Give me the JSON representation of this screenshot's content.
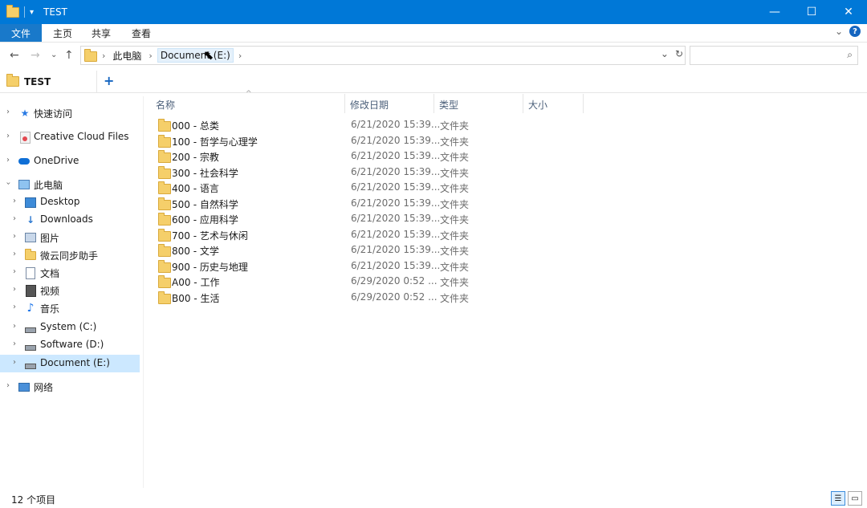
{
  "window": {
    "title": "TEST",
    "controls": {
      "minimize": "—",
      "maximize": "☐",
      "close": "✕"
    }
  },
  "ribbon": {
    "file_tab": "文件",
    "tabs": [
      "主页",
      "共享",
      "查看"
    ],
    "collapse_glyph": "⌄",
    "help_glyph": "?"
  },
  "address": {
    "back": "←",
    "forward": "→",
    "history": "⌄",
    "up": "↑",
    "crumbs": [
      "此电脑",
      "Document (E:)"
    ],
    "dropdown": "⌄",
    "refresh": "↻"
  },
  "search": {
    "placeholder": "",
    "icon": "search-icon"
  },
  "tabbar": {
    "tab_label": "TEST",
    "add_glyph": "+"
  },
  "nav": {
    "items": [
      {
        "label": "快速访问",
        "icon": "star-icon"
      },
      {
        "label": "Creative Cloud Files",
        "icon": "creative-cloud-icon"
      },
      {
        "label": "OneDrive",
        "icon": "cloud-icon"
      },
      {
        "label": "此电脑",
        "icon": "computer-icon"
      },
      {
        "label": "Desktop",
        "icon": "desktop-icon"
      },
      {
        "label": "Downloads",
        "icon": "download-icon"
      },
      {
        "label": "图片",
        "icon": "pictures-icon"
      },
      {
        "label": "微云同步助手",
        "icon": "weiyun-icon"
      },
      {
        "label": "文档",
        "icon": "documents-icon"
      },
      {
        "label": "视频",
        "icon": "video-icon"
      },
      {
        "label": "音乐",
        "icon": "music-icon"
      },
      {
        "label": "System (C:)",
        "icon": "drive-c-icon"
      },
      {
        "label": "Software (D:)",
        "icon": "drive-icon"
      },
      {
        "label": "Document (E:)",
        "icon": "drive-icon"
      },
      {
        "label": "网络",
        "icon": "network-icon"
      }
    ]
  },
  "columns": {
    "name": "名称",
    "date": "修改日期",
    "type": "类型",
    "size": "大小"
  },
  "files": [
    {
      "name": "000 - 总类",
      "date": "6/21/2020 15:39...",
      "type": "文件夹"
    },
    {
      "name": "100 - 哲学与心理学",
      "date": "6/21/2020 15:39...",
      "type": "文件夹"
    },
    {
      "name": "200 - 宗教",
      "date": "6/21/2020 15:39...",
      "type": "文件夹"
    },
    {
      "name": "300 - 社会科学",
      "date": "6/21/2020 15:39...",
      "type": "文件夹"
    },
    {
      "name": "400 - 语言",
      "date": "6/21/2020 15:39...",
      "type": "文件夹"
    },
    {
      "name": "500 - 自然科学",
      "date": "6/21/2020 15:39...",
      "type": "文件夹"
    },
    {
      "name": "600 - 应用科学",
      "date": "6/21/2020 15:39...",
      "type": "文件夹"
    },
    {
      "name": "700 - 艺术与休闲",
      "date": "6/21/2020 15:39...",
      "type": "文件夹"
    },
    {
      "name": "800 - 文学",
      "date": "6/21/2020 15:39...",
      "type": "文件夹"
    },
    {
      "name": "900 - 历史与地理",
      "date": "6/21/2020 15:39...",
      "type": "文件夹"
    },
    {
      "name": "A00 - 工作",
      "date": "6/29/2020 0:52 ...",
      "type": "文件夹"
    },
    {
      "name": "B00 - 生活",
      "date": "6/29/2020 0:52 ...",
      "type": "文件夹"
    }
  ],
  "status": {
    "count": "12 个项目"
  },
  "colors": {
    "titlebar": "#0078d7",
    "selected": "#cce8ff",
    "folder": "#f5cf6a"
  }
}
